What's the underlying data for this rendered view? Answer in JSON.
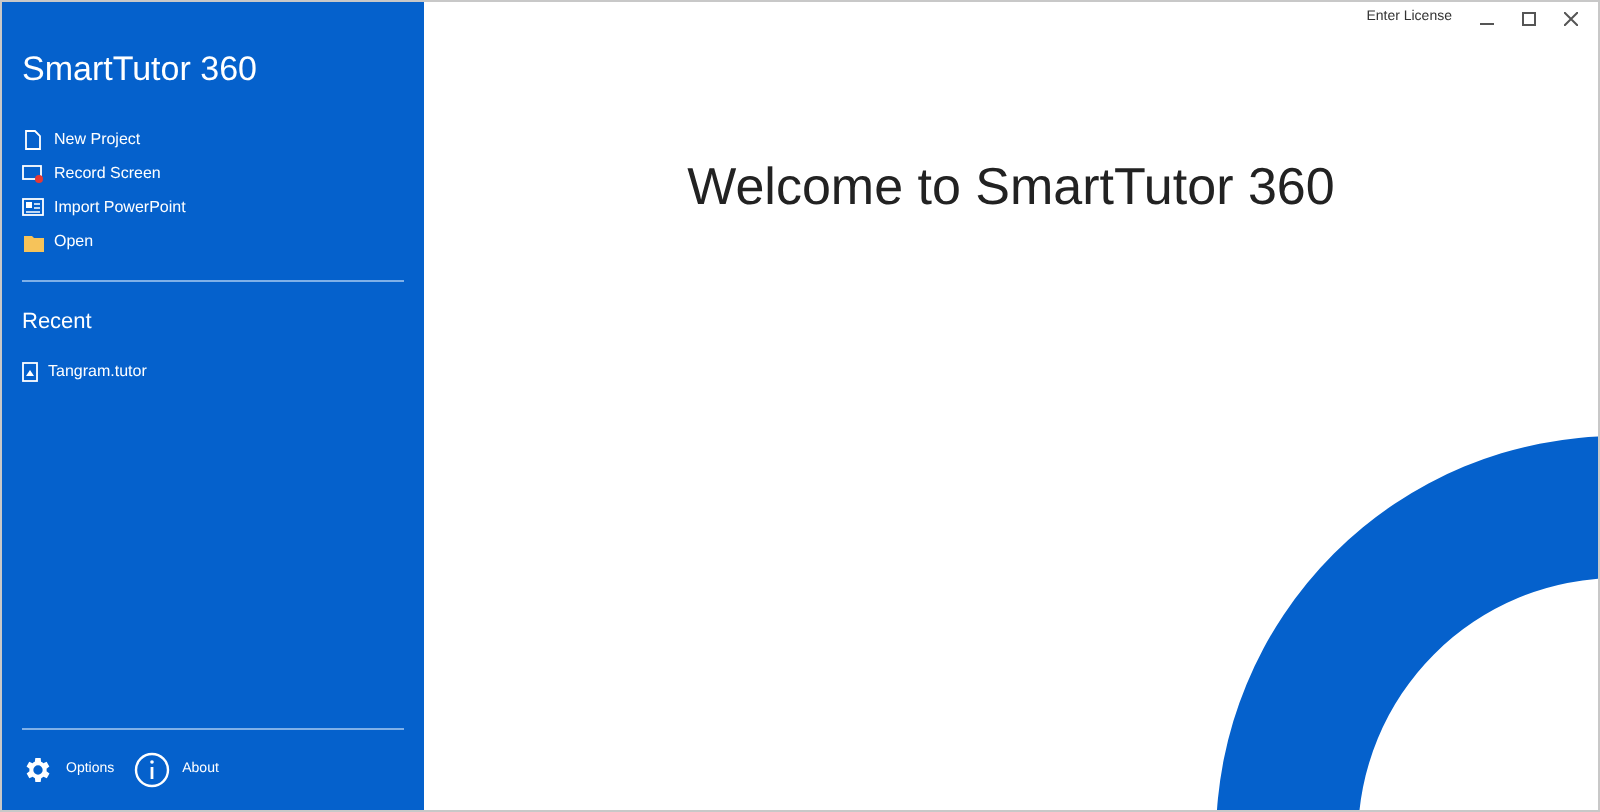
{
  "sidebar": {
    "title": "SmartTutor 360",
    "actions": [
      {
        "kind": "new",
        "label": "New Project"
      },
      {
        "kind": "record",
        "label": "Record Screen"
      },
      {
        "kind": "import",
        "label": "Import PowerPoint"
      },
      {
        "kind": "open",
        "label": "Open"
      }
    ],
    "recent_heading": "Recent",
    "recent": [
      {
        "label": "Tangram.tutor"
      }
    ],
    "footer": [
      {
        "kind": "options",
        "label": "Options"
      },
      {
        "kind": "about",
        "label": "About"
      }
    ]
  },
  "title_bar": {
    "link": "Enter License"
  },
  "main": {
    "heading": "Welcome to SmartTutor 360"
  }
}
